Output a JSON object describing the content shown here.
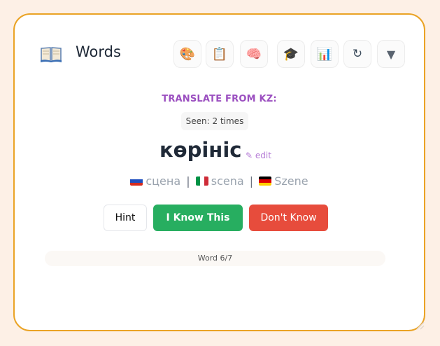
{
  "app": {
    "title": "Words",
    "icon": "book-icon"
  },
  "toolbar": [
    {
      "name": "palette-button",
      "icon": "palette-icon",
      "glyph": "🎨"
    },
    {
      "name": "clipboard-button",
      "icon": "clipboard-icon",
      "glyph": "📋"
    },
    {
      "name": "brain-button",
      "icon": "brain-icon",
      "glyph": "🧠"
    },
    {
      "name": "graduation-button",
      "icon": "graduation-cap-icon",
      "glyph": "🎓"
    },
    {
      "name": "stats-button",
      "icon": "bar-chart-icon",
      "glyph": "📊"
    },
    {
      "name": "refresh-button",
      "icon": "refresh-icon",
      "glyph": "↻"
    },
    {
      "name": "dropdown-button",
      "icon": "triangle-down-icon",
      "glyph": "▼"
    }
  ],
  "card": {
    "prompt": "TRANSLATE FROM KZ:",
    "seen": "Seen: 2 times",
    "word": "көрініс",
    "edit_label": "✎ edit",
    "translations": [
      {
        "lang": "ru",
        "flag_icon": "russia-flag-icon",
        "text": "сцена"
      },
      {
        "lang": "it",
        "flag_icon": "italy-flag-icon",
        "text": "scena"
      },
      {
        "lang": "de",
        "flag_icon": "germany-flag-icon",
        "text": "Szene"
      }
    ],
    "separator": "|"
  },
  "actions": {
    "hint": "Hint",
    "know": "I Know This",
    "dont_know": "Don't Know"
  },
  "progress": {
    "label": "Word 6/7"
  },
  "colors": {
    "border": "#eaa325",
    "prompt": "#9b4fc0",
    "know": "#27ae60",
    "dont_know": "#e74c3c"
  }
}
